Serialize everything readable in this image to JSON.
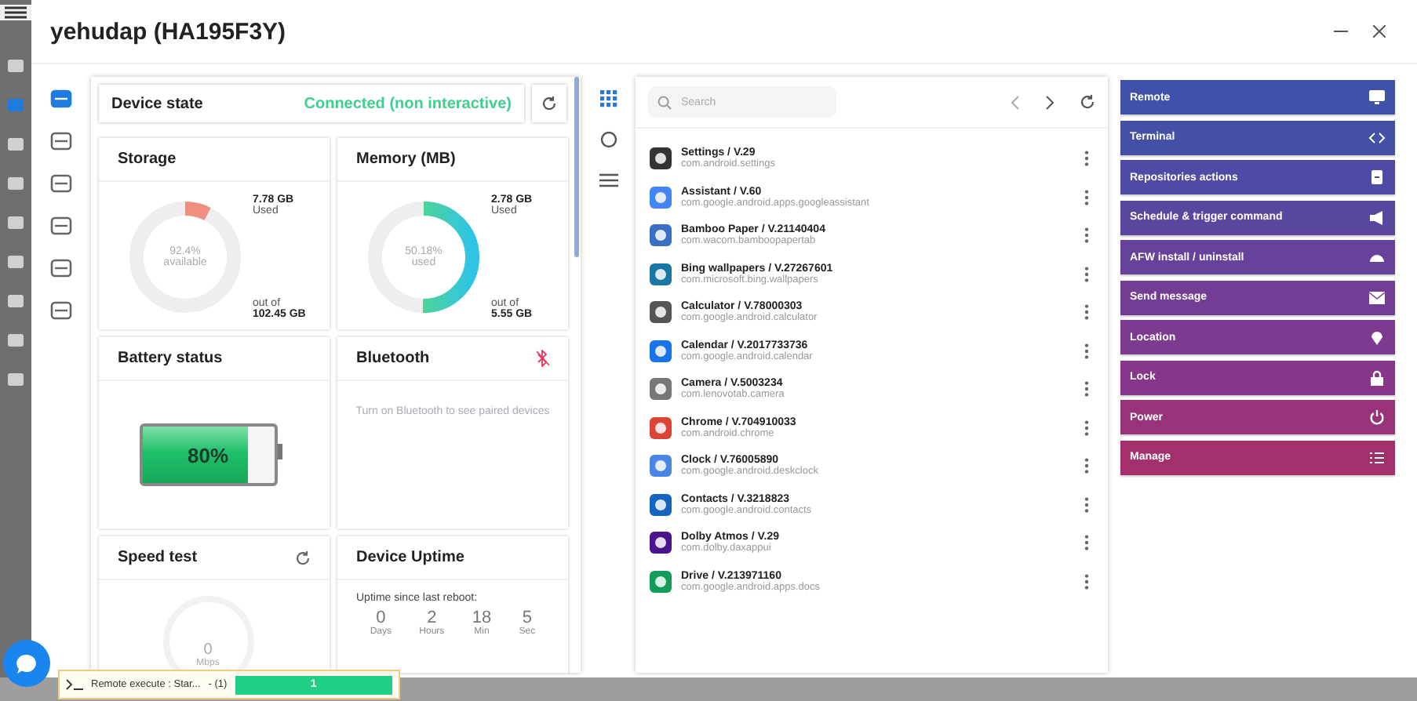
{
  "rail": [
    {
      "selected": false
    },
    {
      "selected": true
    },
    {
      "selected": false
    },
    {
      "selected": false
    },
    {
      "selected": false
    },
    {
      "selected": false
    },
    {
      "selected": false
    },
    {
      "selected": false
    },
    {
      "selected": false
    }
  ],
  "window": {
    "title": "yehudap (HA195F3Y)"
  },
  "subnav": [
    {
      "selected": true
    },
    {
      "selected": false
    },
    {
      "selected": false
    },
    {
      "selected": false
    },
    {
      "selected": false
    },
    {
      "selected": false
    }
  ],
  "device_state": {
    "label": "Device state",
    "status": "Connected (non interactive)"
  },
  "storage": {
    "title": "Storage",
    "level": 0.076,
    "center_value": "92.4%",
    "center_label": "available",
    "used_value": "7.78 GB",
    "used_label": "Used",
    "total_label": "out of",
    "total_value": "102.45 GB"
  },
  "memory": {
    "title": "Memory (MB)",
    "level": 0.5018,
    "center_value": "50.18%",
    "center_label": "used",
    "used_value": "2.78 GB",
    "used_label": "Used",
    "total_label": "out of",
    "total_value": "5.55 GB"
  },
  "battery": {
    "title": "Battery status",
    "level": 0.8,
    "reading": "80%"
  },
  "bluetooth": {
    "title": "Bluetooth",
    "on": false,
    "message": "Turn on Bluetooth to see paired devices"
  },
  "speed_test": {
    "title": "Speed test",
    "value": "0",
    "unit": "Mbps"
  },
  "uptime": {
    "title": "Device Uptime",
    "caption": "Uptime since last reboot:",
    "parts": [
      {
        "value": "0",
        "unit": "Days"
      },
      {
        "value": "2",
        "unit": "Hours"
      },
      {
        "value": "18",
        "unit": "Min"
      },
      {
        "value": "5",
        "unit": "Sec"
      }
    ]
  },
  "midnav": [
    {
      "selected": true
    },
    {
      "selected": false
    },
    {
      "selected": false
    }
  ],
  "search": {
    "placeholder": "Search"
  },
  "apps": [
    {
      "name": "Settings / V.29",
      "package": "com.android.settings"
    },
    {
      "name": "Assistant / V.60",
      "package": "com.google.android.apps.googleassistant"
    },
    {
      "name": "Bamboo Paper / V.21140404",
      "package": "com.wacom.bamboopapertab"
    },
    {
      "name": "Bing wallpapers / V.27267601",
      "package": "com.microsoft.bing.wallpapers"
    },
    {
      "name": "Calculator / V.78000303",
      "package": "com.google.android.calculator"
    },
    {
      "name": "Calendar / V.2017733736",
      "package": "com.google.android.calendar"
    },
    {
      "name": "Camera / V.5003234",
      "package": "com.lenovotab.camera"
    },
    {
      "name": "Chrome / V.704910033",
      "package": "com.android.chrome"
    },
    {
      "name": "Clock / V.76005890",
      "package": "com.google.android.deskclock"
    },
    {
      "name": "Contacts / V.3218823",
      "package": "com.google.android.contacts"
    },
    {
      "name": "Dolby Atmos / V.29",
      "package": "com.dolby.daxappui"
    },
    {
      "name": "Drive / V.213971160",
      "package": "com.google.android.apps.docs"
    }
  ],
  "actions": [
    "Remote",
    "Terminal",
    "Repositories actions",
    "Schedule & trigger command",
    "AFW install / uninstall",
    "Send message",
    "Location",
    "Lock",
    "Power",
    "Manage"
  ],
  "toast": {
    "text": "Remote execute : Star...",
    "count": "- (1)",
    "level": 1,
    "progress_label": "1"
  }
}
